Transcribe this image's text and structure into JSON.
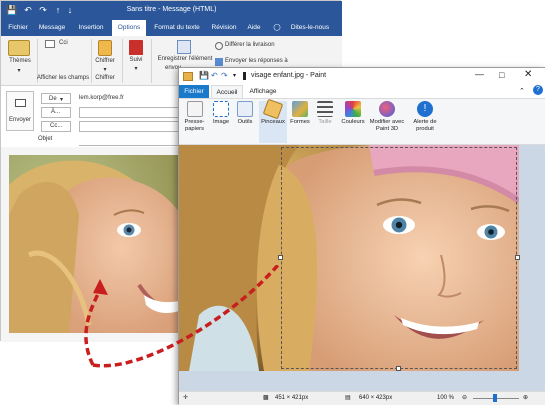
{
  "outlook": {
    "title": "Sans titre  -  Message (HTML)",
    "qa_icons": [
      "save-icon",
      "undo-icon",
      "redo-icon",
      "arrow-up-icon",
      "arrow-down-icon"
    ],
    "tabs": [
      "Fichier",
      "Message",
      "Insertion",
      "Options",
      "Format du texte",
      "Révision",
      "Aide",
      "Dites-le-nous"
    ],
    "active_tab": "Options",
    "ribbon": {
      "themes": "Thèmes",
      "cci": "Cci",
      "afficher_champs": "Afficher les champs",
      "chiffrer": "Chiffrer",
      "chiffrer_group": "Chiffrer",
      "suivi": "Suivi",
      "enregistrer": "Enregistrer l'élément",
      "envoy": "envoy",
      "differer": "Différer la livraison",
      "envoyer_reponses": "Envoyer les réponses à"
    },
    "header": {
      "envoyer": "Envoyer",
      "de": "De",
      "from_value": "lem.korp@free.fr",
      "a": "À...",
      "cc": "Cc...",
      "objet": "Objet"
    }
  },
  "paint": {
    "title": "visage enfant.jpg - Paint",
    "tabs": [
      "Fichier",
      "Accueil",
      "Affichage"
    ],
    "active_tab": "Accueil",
    "ribbon": {
      "presse": "Presse-papiers",
      "image": "Image",
      "outils": "Outils",
      "pinceaux": "Pinceaux",
      "formes": "Formes",
      "taille": "Taille",
      "couleurs": "Couleurs",
      "paint3d": "Modifier avec Paint 3D",
      "alerte": "Alerte de produit"
    },
    "status": {
      "selection_size": "451 × 421px",
      "image_size": "640 × 423px",
      "zoom": "100 %"
    }
  }
}
